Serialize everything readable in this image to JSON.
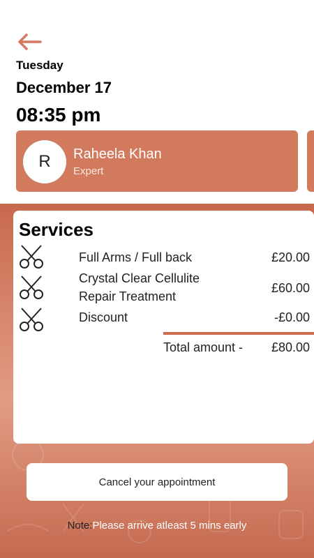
{
  "header": {
    "day": "Tuesday",
    "date": "December 17",
    "time": "08:35 pm"
  },
  "expert": {
    "initial": "R",
    "name": "Raheela Khan",
    "role": "Expert"
  },
  "services": {
    "title": "Services",
    "items": [
      {
        "name": "Full Arms / Full back",
        "price": "£20.00",
        "icon": "scissors-icon"
      },
      {
        "name": "Crystal Clear Cellulite Repair Treatment",
        "price": "£60.00",
        "icon": "scissors-icon"
      },
      {
        "name": "Discount",
        "price": "-£0.00",
        "icon": "scissors-icon"
      }
    ],
    "total_label": "Total amount -",
    "total_amount": "£80.00"
  },
  "actions": {
    "cancel_label": "Cancel your appointment"
  },
  "note": {
    "label": "Note:",
    "text": "Please arrive atleast 5 mins early"
  },
  "colors": {
    "accent": "#d27a5e",
    "background_gradient": "#c8694d"
  }
}
